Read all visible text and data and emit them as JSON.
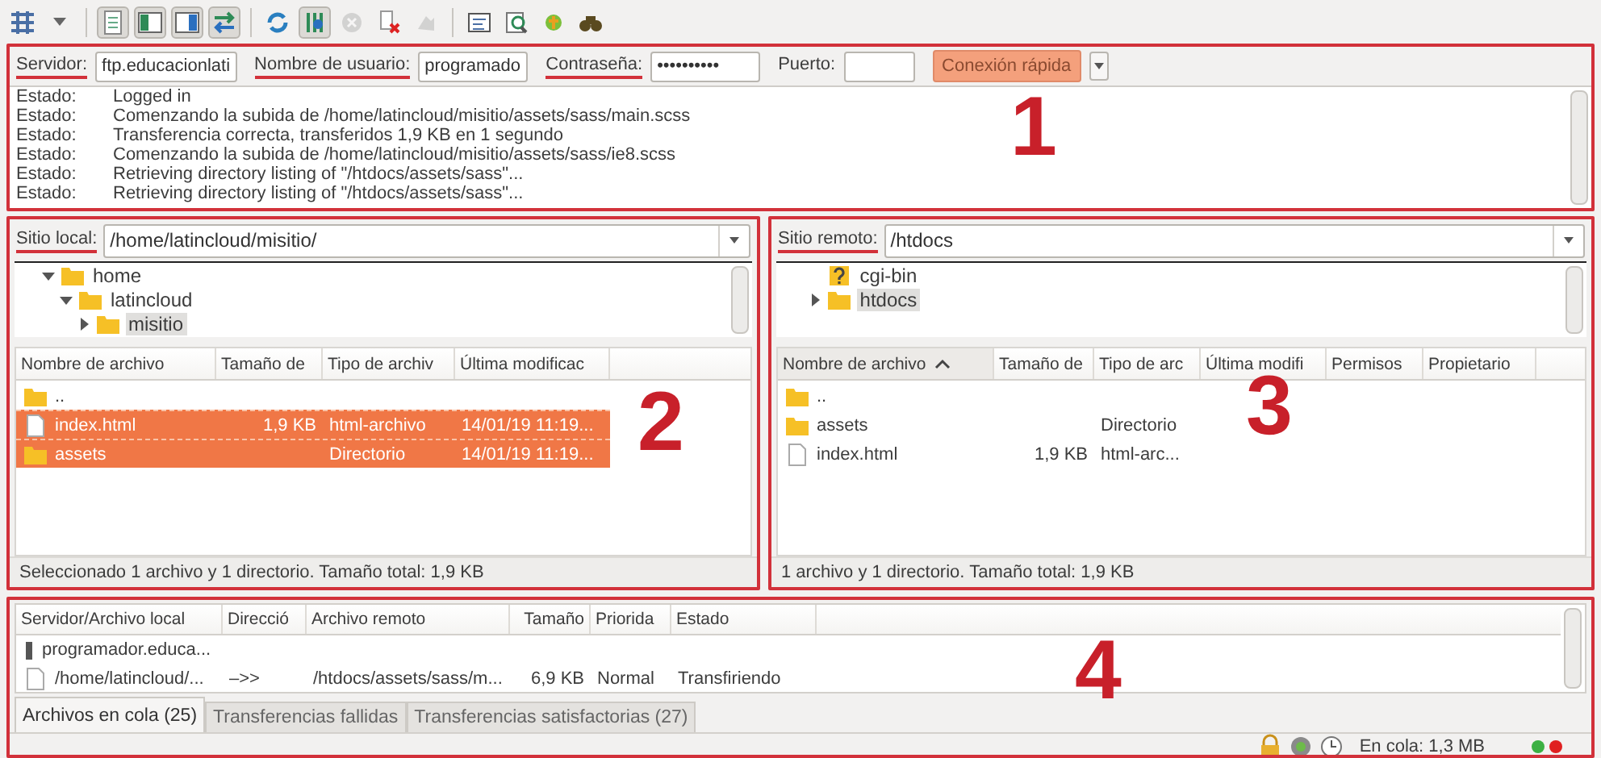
{
  "toolbar": [
    {
      "kind": "site-manager",
      "pressed": false,
      "disabled": false
    },
    {
      "kind": "dropdown",
      "pressed": false,
      "disabled": false
    },
    {
      "kind": "separator"
    },
    {
      "kind": "log",
      "pressed": true,
      "disabled": false
    },
    {
      "kind": "local-tree",
      "pressed": true,
      "disabled": false
    },
    {
      "kind": "remote-tree",
      "pressed": true,
      "disabled": false
    },
    {
      "kind": "queue",
      "pressed": true,
      "disabled": false
    },
    {
      "kind": "separator"
    },
    {
      "kind": "refresh",
      "pressed": false,
      "disabled": false
    },
    {
      "kind": "process-queue",
      "pressed": true,
      "disabled": false
    },
    {
      "kind": "cancel",
      "pressed": false,
      "disabled": true
    },
    {
      "kind": "disconnect",
      "pressed": false,
      "disabled": false
    },
    {
      "kind": "reconnect",
      "pressed": false,
      "disabled": true
    },
    {
      "kind": "separator"
    },
    {
      "kind": "filter",
      "pressed": false,
      "disabled": false
    },
    {
      "kind": "compare",
      "pressed": false,
      "disabled": false
    },
    {
      "kind": "sync",
      "pressed": false,
      "disabled": false
    },
    {
      "kind": "search",
      "pressed": false,
      "disabled": false
    }
  ],
  "quickconnect": {
    "marker": "1",
    "fields": [
      {
        "label": "Servidor:",
        "value": "ftp.educacionlati",
        "underlined": true
      },
      {
        "label": "Nombre de usuario:",
        "value": "programado",
        "underlined": true
      },
      {
        "label": "Contraseña:",
        "value": "••••••••••",
        "underlined": true
      },
      {
        "label": "Puerto:",
        "underlined": false
      }
    ],
    "button": "Conexión rápida",
    "log": [
      {
        "label": "Estado:",
        "message": "Logged in"
      },
      {
        "label": "Estado:",
        "message": "Comenzando la subida de /home/latincloud/misitio/assets/sass/main.scss"
      },
      {
        "label": "Estado:",
        "message": "Transferencia correcta, transferidos 1,9 KB en 1 segundo"
      },
      {
        "label": "Estado:",
        "message": "Comenzando la subida de /home/latincloud/misitio/assets/sass/ie8.scss"
      },
      {
        "label": "Estado:",
        "message": "Retrieving directory listing of \"/htdocs/assets/sass\"..."
      },
      {
        "label": "Estado:",
        "message": "Retrieving directory listing of \"/htdocs/assets/sass\"..."
      }
    ]
  },
  "panels": [
    {
      "marker": "2",
      "site_label": "Sitio local:",
      "path": "/home/latincloud/misitio/",
      "tree": [
        {
          "label": "home",
          "kind": "folder",
          "expanded": true,
          "selected": false,
          "children": [
            {
              "label": "latincloud",
              "kind": "folder",
              "expanded": true,
              "selected": false,
              "children": [
                {
                  "label": "misitio",
                  "kind": "folder",
                  "expanded": false,
                  "selected": true
                }
              ]
            }
          ]
        }
      ],
      "columns": [
        {
          "label": "Nombre de archivo"
        },
        {
          "label": "Tamaño de"
        },
        {
          "label": "Tipo de archiv"
        },
        {
          "label": "Última modificac"
        }
      ],
      "rows": [
        {
          "kind": "folder",
          "selected": false,
          "cells": [
            ".."
          ]
        },
        {
          "kind": "file",
          "selected": true,
          "cells": [
            "index.html",
            "1,9 KB",
            "html-archivo",
            "14/01/19 11:19..."
          ]
        },
        {
          "kind": "folder",
          "selected": true,
          "cells": [
            "assets",
            "",
            "Directorio",
            "14/01/19 11:19..."
          ]
        }
      ],
      "status": "Seleccionado 1 archivo y 1 directorio. Tamaño total: 1,9 KB"
    },
    {
      "marker": "3",
      "site_label": "Sitio remoto:",
      "path": "/htdocs",
      "tree": [
        {
          "label": "cgi-bin",
          "kind": "unknown",
          "selected": false
        },
        {
          "label": "htdocs",
          "kind": "folder",
          "expanded": false,
          "selected": true
        }
      ],
      "columns": [
        {
          "label": "Nombre de archivo",
          "sorted": true
        },
        {
          "label": "Tamaño de",
          "sorted": false
        },
        {
          "label": "Tipo de arc",
          "sorted": false
        },
        {
          "label": "Última modifi",
          "sorted": false
        },
        {
          "label": "Permisos",
          "sorted": false
        },
        {
          "label": "Propietario",
          "sorted": false
        }
      ],
      "rows": [
        {
          "kind": "folder",
          "selected": false,
          "cells": [
            ".."
          ]
        },
        {
          "kind": "folder",
          "selected": false,
          "cells": [
            "assets",
            "",
            "Directorio"
          ]
        },
        {
          "kind": "file",
          "selected": false,
          "cells": [
            "index.html",
            "1,9 KB",
            "html-arc..."
          ]
        }
      ],
      "status": "1 archivo y 1 directorio. Tamaño total: 1,9 KB"
    }
  ],
  "queue": {
    "marker": "4",
    "columns": [
      {
        "label": "Servidor/Archivo local"
      },
      {
        "label": "Direcció"
      },
      {
        "label": "Archivo remoto"
      },
      {
        "label": "Tamaño"
      },
      {
        "label": "Priorida"
      },
      {
        "label": "Estado"
      }
    ],
    "rows": [
      {
        "kind": "server",
        "cells": [
          "programador.educa..."
        ]
      },
      {
        "kind": "file",
        "cells": [
          "/home/latincloud/...",
          "–>>",
          "/htdocs/assets/sass/m...",
          "6,9 KB",
          "Normal",
          "Transfiriendo"
        ]
      }
    ],
    "tabs": [
      {
        "label": "Archivos en cola (25)",
        "selected": true
      },
      {
        "label": "Transferencias fallidas",
        "selected": false
      },
      {
        "label": "Transferencias satisfactorias (27)",
        "selected": false
      }
    ],
    "status": "En cola: 1,3 MB",
    "lights": [
      {
        "color": "#3cb043"
      },
      {
        "color": "#e02020"
      }
    ]
  }
}
